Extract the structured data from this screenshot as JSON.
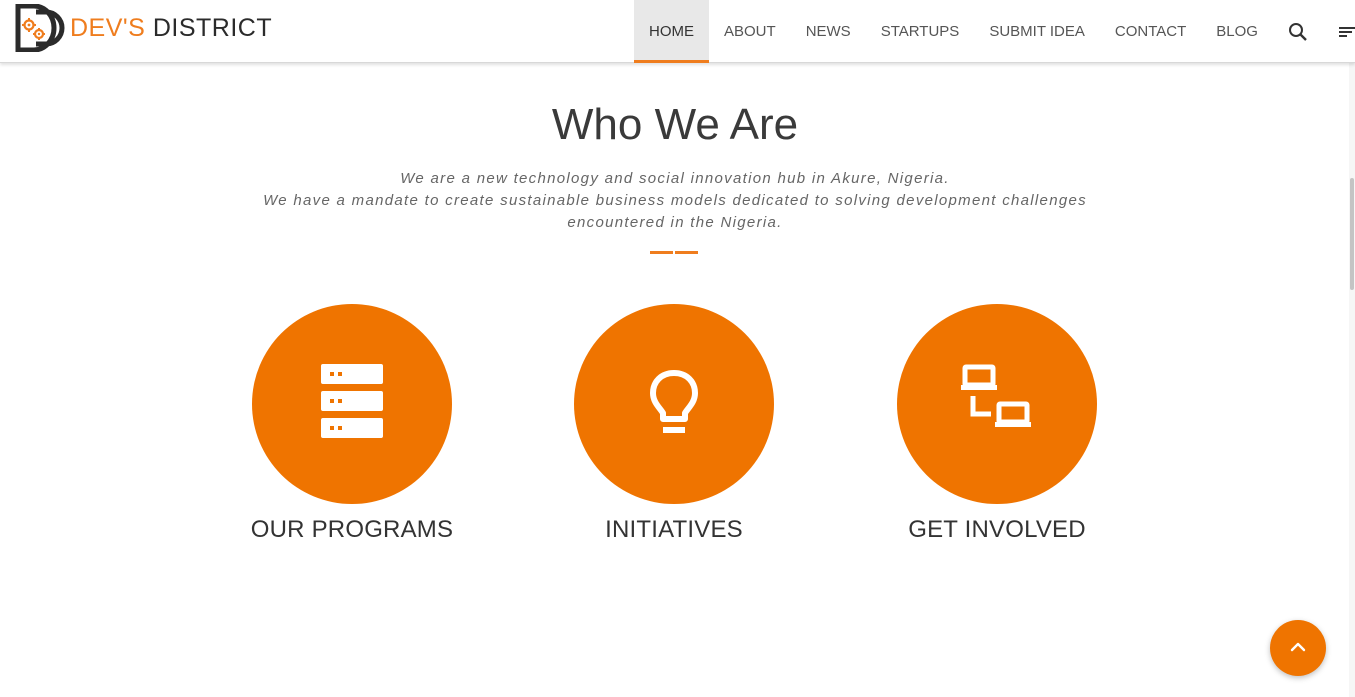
{
  "brand": {
    "part1": "DEV'S",
    "part2": "DISTRICT"
  },
  "nav": {
    "items": [
      {
        "label": "HOME",
        "active": true
      },
      {
        "label": "ABOUT",
        "active": false
      },
      {
        "label": "NEWS",
        "active": false
      },
      {
        "label": "STARTUPS",
        "active": false
      },
      {
        "label": "SUBMIT IDEA",
        "active": false
      },
      {
        "label": "CONTACT",
        "active": false
      },
      {
        "label": "BLOG",
        "active": false
      }
    ],
    "icons": [
      "search-icon",
      "menu-icon"
    ]
  },
  "section": {
    "title": "Who We Are",
    "desc_line1": "We are a new technology and social innovation hub in Akure, Nigeria.",
    "desc_line2": "We have a mandate to create sustainable business models dedicated to solving development challenges encountered in the Nigeria."
  },
  "features": [
    {
      "label": "OUR PROGRAMS",
      "icon": "server-stack-icon"
    },
    {
      "label": "INITIATIVES",
      "icon": "lightbulb-icon"
    },
    {
      "label": "GET INVOLVED",
      "icon": "network-computers-icon"
    }
  ],
  "back_to_top_icon": "chevron-up-icon",
  "colors": {
    "accent": "#ef7400",
    "brand_orange": "#ef7d1e",
    "text_dark": "#333333"
  }
}
